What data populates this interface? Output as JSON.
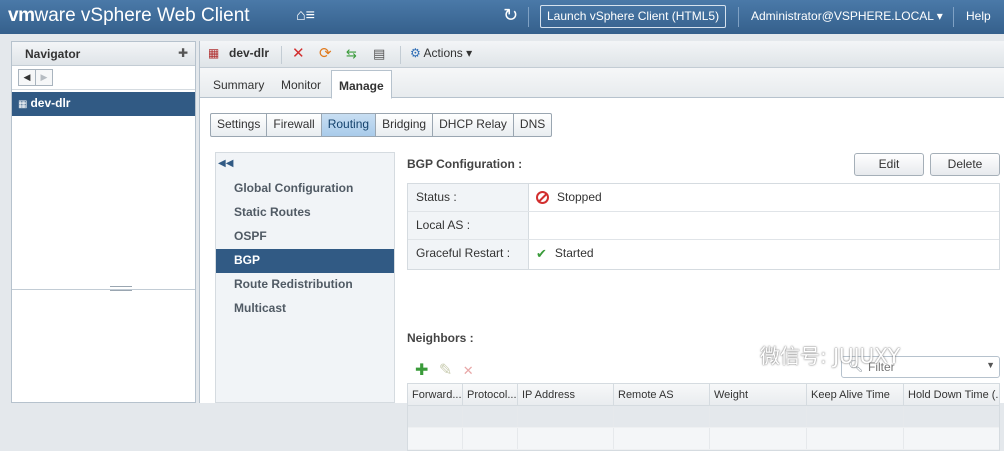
{
  "app": {
    "brand_vm": "vm",
    "brand_ware": "ware",
    "brand_product": " vSphere Web Client",
    "home_glyph": "⌂≡",
    "launch_label": "Launch vSphere Client (HTML5)",
    "user_label": "Administrator@VSPHERE.LOCAL ▾",
    "help_label": "Help"
  },
  "navigator": {
    "title": "Navigator",
    "selected_item": "dev-dlr"
  },
  "object": {
    "name": "dev-dlr",
    "actions_label": "Actions ▾"
  },
  "tabs": [
    "Summary",
    "Monitor",
    "Manage"
  ],
  "subtabs": [
    "Settings",
    "Firewall",
    "Routing",
    "Bridging",
    "DHCP Relay",
    "DNS"
  ],
  "routing_menu": [
    "Global Configuration",
    "Static Routes",
    "OSPF",
    "BGP",
    "Route Redistribution",
    "Multicast"
  ],
  "bgp": {
    "title": "BGP Configuration :",
    "edit_label": "Edit",
    "delete_label": "Delete",
    "status_label": "Status :",
    "status_value": "Stopped",
    "local_as_label": "Local AS :",
    "local_as_value": "",
    "graceful_label": "Graceful Restart :",
    "graceful_value": "Started"
  },
  "neighbors": {
    "title": "Neighbors :",
    "filter_placeholder": "Filter",
    "columns": [
      "Forward...",
      "Protocol...",
      "IP Address",
      "Remote AS",
      "Weight",
      "Keep Alive Time",
      "Hold Down Time (..."
    ]
  },
  "watermark": "微信号: JUJUXY",
  "colors": {
    "topbar": "#3f6b97",
    "selection": "#315a84",
    "stopped": "#d22f2f",
    "started": "#3a9b3a"
  }
}
